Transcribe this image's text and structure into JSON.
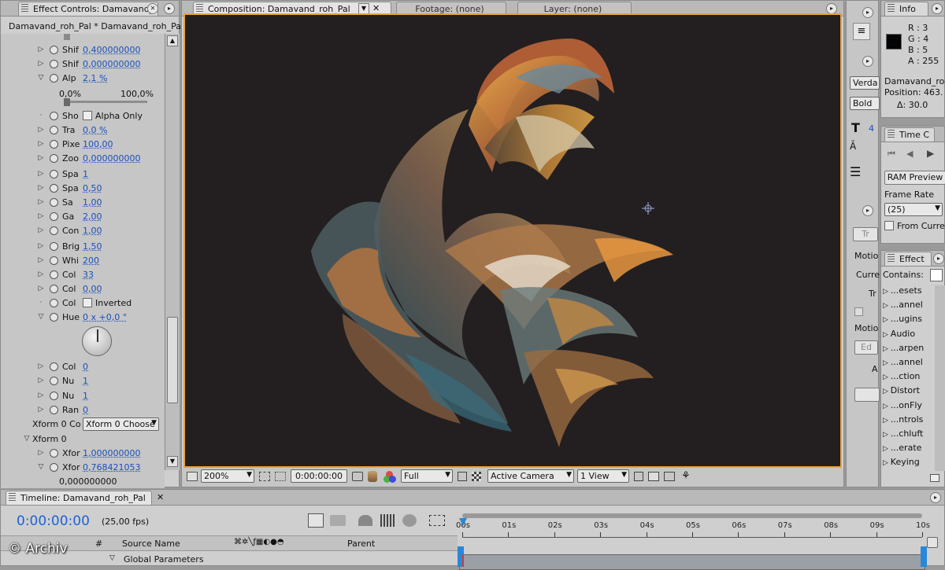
{
  "effect_panel": {
    "tab_title": "Effect Controls: Damavand_r",
    "header": "Damavand_roh_Pal * Damavand_roh_Pal",
    "rows": [
      {
        "name": "Shif",
        "value": "0,400000000",
        "tri": "right"
      },
      {
        "name": "Shif",
        "value": "0,000000000",
        "tri": "right"
      },
      {
        "name": "Alp",
        "value": "2,1 %",
        "tri": "down"
      },
      {
        "name": "Sho",
        "value": "",
        "tri": "none",
        "checkbox": "Alpha Only"
      },
      {
        "name": "Tra",
        "value": "0,0 %",
        "tri": "right"
      },
      {
        "name": "Pixe",
        "value": "100,00",
        "tri": "right"
      },
      {
        "name": "Zoo",
        "value": "0,000000000",
        "tri": "right"
      },
      {
        "name": "Spa",
        "value": "1",
        "tri": "right"
      },
      {
        "name": "Spa",
        "value": "0,50",
        "tri": "right"
      },
      {
        "name": "Sa",
        "value": "1,00",
        "tri": "right"
      },
      {
        "name": "Ga",
        "value": "2,00",
        "tri": "right"
      },
      {
        "name": "Con",
        "value": "1,00",
        "tri": "right"
      },
      {
        "name": "Brig",
        "value": "1,50",
        "tri": "right"
      },
      {
        "name": "Whi",
        "value": "200",
        "tri": "right"
      },
      {
        "name": "Col",
        "value": "33",
        "tri": "right"
      },
      {
        "name": "Col",
        "value": "0,00",
        "tri": "right"
      },
      {
        "name": "Col",
        "value": "",
        "tri": "none",
        "checkbox": "Inverted"
      },
      {
        "name": "Hue",
        "value": "0 x +0,0 °",
        "tri": "down"
      }
    ],
    "rows2": [
      {
        "name": "Col",
        "value": "0"
      },
      {
        "name": "Nu",
        "value": "1"
      },
      {
        "name": "Nu",
        "value": "1"
      },
      {
        "name": "Ran",
        "value": "0"
      }
    ],
    "slider_min": "0,0%",
    "slider_max": "100,0%",
    "xform_label": "Xform 0 Co",
    "xform_select": "Xform 0 Choose",
    "xform_group": "Xform 0",
    "xfor1_name": "Xfor",
    "xfor1_value": "1,000000000",
    "xfor2_name": "Xfor",
    "xfor2_value": "0,768421053",
    "xfor_slider_text": "0,000000000"
  },
  "comp_panel": {
    "tab_comp": "Composition: Damavand_roh_Pal",
    "tab_footage": "Footage: (none)",
    "tab_layer": "Layer: (none)",
    "zoom": "200%",
    "timecode": "0:00:00:00",
    "resolution": "Full",
    "camera": "Active Camera",
    "view": "1 View"
  },
  "info_panel": {
    "tab": "Info",
    "r": "R : 3",
    "g": "G : 4",
    "b": "B : 5",
    "a": "A : 255",
    "name": "Damavand_ro",
    "position": "Position: 463.",
    "delta": "Δ: 30.0"
  },
  "char_panel": {
    "font": "Verda",
    "style": "Bold",
    "size_val": "4"
  },
  "time_panel": {
    "tab": "Time C",
    "ram_preview": "RAM Preview",
    "frame_rate_label": "Frame Rate",
    "frame_rate": "(25)",
    "from_current": "From Curre"
  },
  "motion_panel": {
    "tr": "Tr",
    "motio1": "Motio",
    "curr": "Curre",
    "tr2": "Tr",
    "motio2": "Motio",
    "ed": "Ed",
    "a": "A"
  },
  "effects_panel": {
    "tab": "Effect",
    "contains": "Contains:",
    "items": [
      "...esets",
      "...annel",
      "...ugins",
      "Audio",
      "...arpen",
      "...annel",
      "...ction",
      "Distort",
      "...onFly",
      "...ntrols",
      "...chluft",
      "...erate",
      "Keying"
    ]
  },
  "timeline": {
    "tab": "Timeline: Damavand_roh_Pal",
    "timecode": "0:00:00:00",
    "fps": "(25,00 fps)",
    "ticks": [
      "00s",
      "01s",
      "02s",
      "03s",
      "04s",
      "05s",
      "06s",
      "07s",
      "08s",
      "09s",
      "10s"
    ],
    "col_hash": "#",
    "col_source": "Source Name",
    "col_parent": "Parent",
    "layer_name": "Global Parameters"
  },
  "watermark": "© Archiv",
  "colors": {
    "panel_bg": "#cfcfcf",
    "accent_orange": "#e8a23a",
    "link_blue": "#1a4fb8",
    "timecode_blue": "#1c62d6"
  }
}
